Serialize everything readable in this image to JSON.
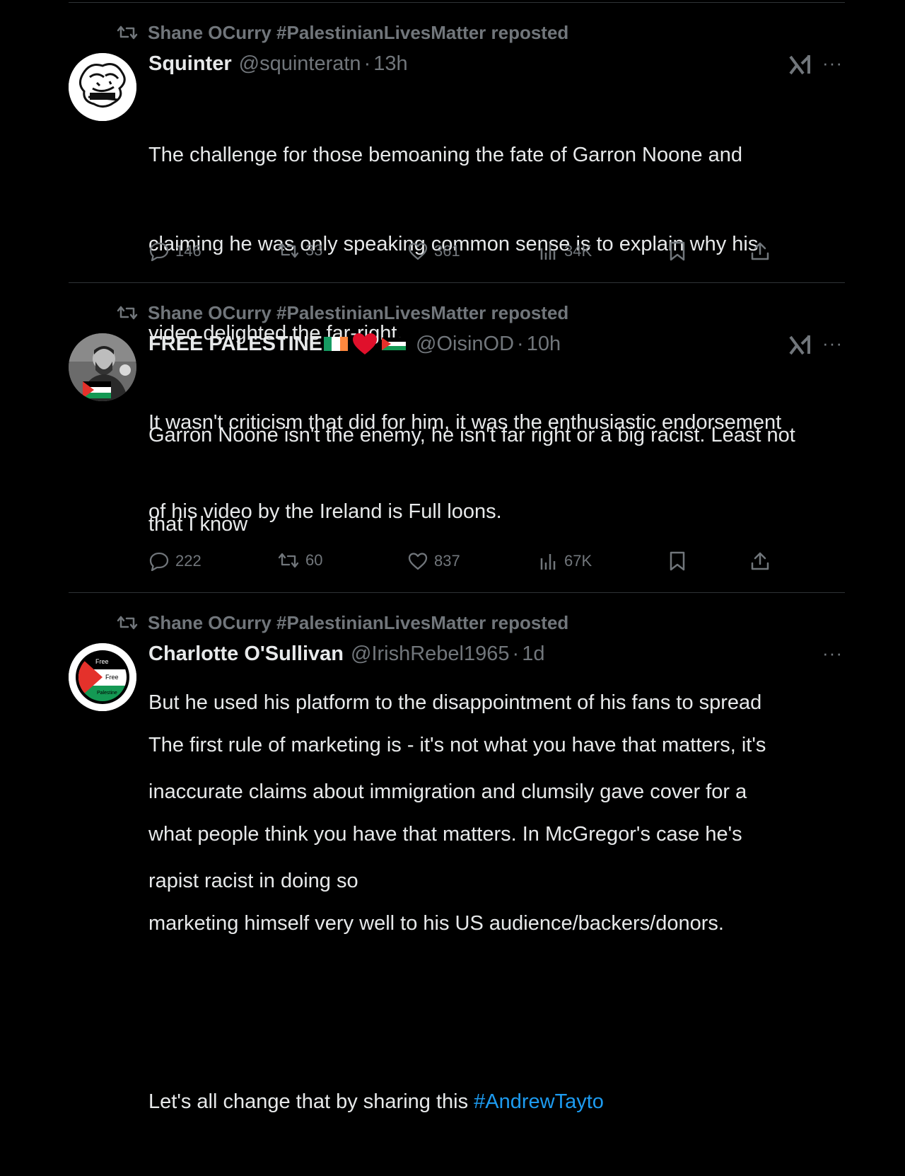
{
  "tweets": [
    {
      "repost_label": "Shane OCurry #PalestinianLivesMatter reposted",
      "name": "Squinter",
      "handle": "@squinteratn",
      "dot": "·",
      "time": "13h",
      "more": "···",
      "lines": [
        "The challenge for those bemoaning the fate of Garron Noone and",
        "claiming he was only speaking common sense is to explain why his",
        "video delighted the far-right.",
        "It wasn't criticism that did for him, it was the enthusiastic endorsement",
        "of his video by the Ireland is Full loons."
      ],
      "replies": "146",
      "reposts": "33",
      "likes": "361",
      "views": "34K"
    },
    {
      "repost_label": "Shane OCurry #PalestinianLivesMatter reposted",
      "name": "FREE PALESTINE",
      "handle": "@OisinOD",
      "dot": "·",
      "time": "10h",
      "more": "···",
      "lines": [
        "Garron Noone isn't the enemy, he isn't far right or a big racist. Least not",
        "that I know",
        "",
        "But he used his platform to the disappointment of his fans to spread",
        "inaccurate claims about immigration and clumsily gave cover for a",
        "rapist racist in doing so"
      ],
      "replies": "222",
      "reposts": "60",
      "likes": "837",
      "views": "67K"
    },
    {
      "repost_label": "Shane OCurry #PalestinianLivesMatter reposted",
      "name": "Charlotte O'Sullivan",
      "handle": "@IrishRebel1965",
      "dot": "·",
      "time": "1d",
      "more": "···",
      "avatar_text": {
        "top": "Free",
        "middle": "Free",
        "bottom": "Palestine"
      },
      "lines": [
        "The first rule of marketing is - it's not what you have that matters, it's",
        "what people think you have that matters. In McGregor's case he's",
        "marketing himself very well to his US audience/backers/donors.",
        "",
        "Let's all change that by sharing this "
      ],
      "hashtag": "#AndrewTayto"
    }
  ],
  "colors": {
    "background": "#000000",
    "text": "#e7e9ea",
    "muted": "#71767b",
    "link": "#1d9bf0",
    "divider": "#2f3336"
  },
  "icons": [
    "repost-icon",
    "reply-icon",
    "like-icon",
    "views-icon",
    "bookmark-icon",
    "share-icon",
    "grok-icon",
    "more-icon"
  ]
}
